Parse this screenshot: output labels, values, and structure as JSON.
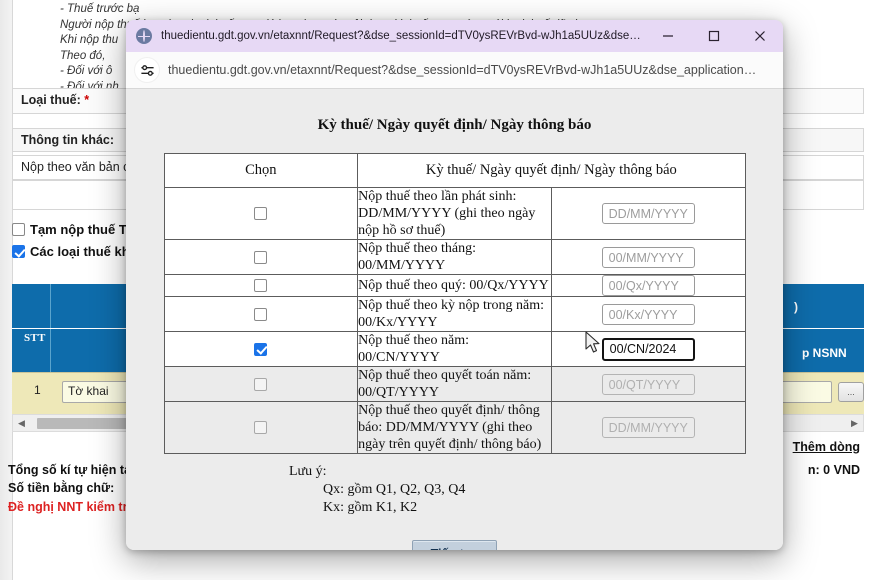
{
  "background": {
    "note_lines": [
      "- Thuế trước bạ",
      "Người nộp thuế lựa chọn loại thuế, sau đó lựa chọn các nội dung kinh tế tương ứng với loại thuế đã chọn.",
      "Khi nộp thu",
      "Theo đó,",
      "- Đối với ô ",
      "- Đối với nh"
    ],
    "loai_thue_label": "Loại thuế",
    "loai_thue_required": "*",
    "thong_tin_khac_label": "Thông tin khác:",
    "nop_theo_van_ban": "Nộp theo văn bản c",
    "checkbox_tam_nop": "Tạm nộp thuế TN",
    "checkbox_cac_loai": "Các loại thuế khá",
    "grid_header_stt": "STT",
    "grid_header_right_1": ")",
    "grid_header_right_2": "p NSNN",
    "grid_row_num": "1",
    "grid_row_cell": "Tờ khai",
    "ellipsis_button": "...",
    "scroll_left_arrow": "◀",
    "scroll_right_arrow": "▶",
    "them_dong_link": "Thêm dòng",
    "tong_so_ki_tu": "Tổng số kí tự hiện tại",
    "so_tien_bang_chu": "Số tiền bằng chữ:",
    "de_nghi_nnt": "Đề nghị NNT kiểm tra",
    "tien_vnd": "n: 0 VND"
  },
  "window": {
    "title": "thuedientu.gdt.gov.vn/etaxnnt/Request?&dse_sessionId=dTV0ysREVrBvd-wJh1a5UUz&dse_applicati…",
    "address": "thuedientu.gdt.gov.vn/etaxnnt/Request?&dse_sessionId=dTV0ysREVrBvd-wJh1a5UUz&dse_application…",
    "minimize_label": "Minimize",
    "maximize_label": "Maximize",
    "close_label": "Close",
    "titlebar_color": "#e7d9f5"
  },
  "modal": {
    "title": "Kỳ thuế/ Ngày quyết định/ Ngày thông báo",
    "table": {
      "headers": [
        "Chọn",
        "Kỳ thuế/ Ngày quyết định/ Ngày thông báo",
        ""
      ],
      "rows": [
        {
          "checked": false,
          "disabled": false,
          "description": "Nộp thuế theo lần phát sinh: DD/MM/YYYY (ghi theo ngày nộp hồ sơ thuế)",
          "input_value": "DD/MM/YYYY",
          "input_is_placeholder": true
        },
        {
          "checked": false,
          "disabled": false,
          "description": "Nộp thuế theo tháng: 00/MM/YYYY",
          "input_value": "00/MM/YYYY",
          "input_is_placeholder": true
        },
        {
          "checked": false,
          "disabled": false,
          "description": "Nộp thuế theo quý: 00/Qx/YYYY",
          "input_value": "00/Qx/YYYY",
          "input_is_placeholder": true
        },
        {
          "checked": false,
          "disabled": false,
          "description": "Nộp thuế theo kỳ nộp trong năm: 00/Kx/YYYY",
          "input_value": "00/Kx/YYYY",
          "input_is_placeholder": true
        },
        {
          "checked": true,
          "disabled": false,
          "description": "Nộp thuế theo năm: 00/CN/YYYY",
          "input_value": "00/CN/2024",
          "input_is_placeholder": false
        },
        {
          "checked": false,
          "disabled": true,
          "description": "Nộp thuế theo quyết toán năm: 00/QT/YYYY",
          "input_value": "00/QT/YYYY",
          "input_is_placeholder": true
        },
        {
          "checked": false,
          "disabled": true,
          "description": "Nộp thuế theo quyết định/ thông báo: DD/MM/YYYY (ghi theo ngày trên quyết định/ thông báo)",
          "input_value": "DD/MM/YYYY",
          "input_is_placeholder": true
        }
      ]
    },
    "notes_title": "Lưu ý:",
    "notes_line_1": "Qx: gồm Q1, Q2, Q3, Q4",
    "notes_line_2": "Kx: gồm K1, K2",
    "continue_button": "Tiếp tục"
  }
}
